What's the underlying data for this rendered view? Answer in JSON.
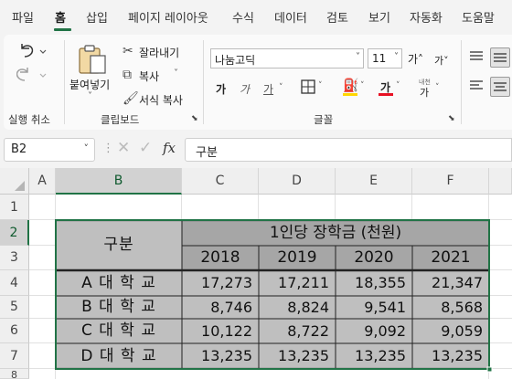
{
  "menu": {
    "items": [
      "파일",
      "홈",
      "삽입",
      "페이지 레이아웃",
      "수식",
      "데이터",
      "검토",
      "보기",
      "자동화",
      "도움말"
    ],
    "active_index": 1
  },
  "ribbon": {
    "undo": {
      "group_label": "실행 취소"
    },
    "clipboard": {
      "paste_label": "붙여넣기",
      "cut_label": "잘라내기",
      "copy_label": "복사",
      "format_painter_label": "서식 복사",
      "group_label": "클립보드"
    },
    "font": {
      "font_name": "나눔고딕",
      "font_size": "11",
      "grow_label": "가˄",
      "shrink_label": "가˅",
      "bold_label": "가",
      "italic_label": "가",
      "underline_label": "가",
      "font_color_label": "가",
      "phonetic_top": "내천",
      "phonetic_bottom": "가",
      "group_label": "글꼴"
    }
  },
  "formula_bar": {
    "name_box": "B2",
    "fx_label": "fx",
    "content": "구분"
  },
  "sheet": {
    "columns": [
      "A",
      "B",
      "C",
      "D",
      "E",
      "F"
    ],
    "rows": [
      "1",
      "2",
      "3",
      "4",
      "5",
      "6",
      "7",
      "8"
    ],
    "selected_cell": "B2",
    "header_cell": "구분",
    "title": "1인당 장학금 (천원)",
    "years": [
      "2018",
      "2019",
      "2020",
      "2021"
    ],
    "data_rows": [
      {
        "label": "A 대 학 교",
        "values": [
          "17,273",
          "17,211",
          "18,355",
          "21,347"
        ]
      },
      {
        "label": "B 대 학 교",
        "values": [
          "8,746",
          "8,824",
          "9,541",
          "8,568"
        ]
      },
      {
        "label": "C 대 학 교",
        "values": [
          "10,122",
          "8,722",
          "9,092",
          "9,059"
        ]
      },
      {
        "label": "D 대 학 교",
        "values": [
          "13,235",
          "13,235",
          "13,235",
          "13,235"
        ]
      }
    ]
  },
  "colors": {
    "accent": "#217346",
    "table_light_gray": "#bfbfbf",
    "table_dark_gray": "#a6a6a6",
    "font_color_underline": "#e81123",
    "fill_color_underline": "#ffd600"
  }
}
